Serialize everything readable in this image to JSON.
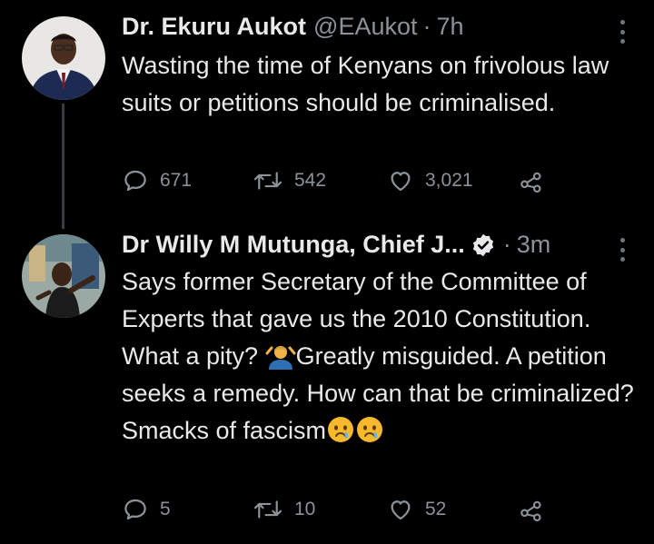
{
  "tweet1": {
    "name": "Dr. Ekuru Aukot",
    "handle": "@EAukot",
    "separator": "·",
    "time": "7h",
    "text": "Wasting the time of Kenyans on frivolous law suits or petitions should be criminalised.",
    "replies": "671",
    "retweets": "542",
    "likes": "3,021"
  },
  "tweet2": {
    "name": "Dr Willy M Mutunga, Chief J...",
    "separator": "·",
    "time": "3m",
    "text_part1": "Says former Secretary of the Committee of Experts that gave us the 2010 Constitution. What a pity? ",
    "text_part2": "Greatly misguided. A petition seeks a remedy. How can that be criminalized? Smacks of fascism",
    "replies": "5",
    "retweets": "10",
    "likes": "52"
  },
  "colors": {
    "background": "#000000",
    "text": "#e7e9ea",
    "muted": "#8b9298",
    "thread_line": "#3a3d40"
  },
  "icons": [
    "reply-icon",
    "retweet-icon",
    "like-icon",
    "share-icon",
    "more-icon",
    "verified-badge-icon",
    "shrug-emoji",
    "crying-face-emoji"
  ]
}
